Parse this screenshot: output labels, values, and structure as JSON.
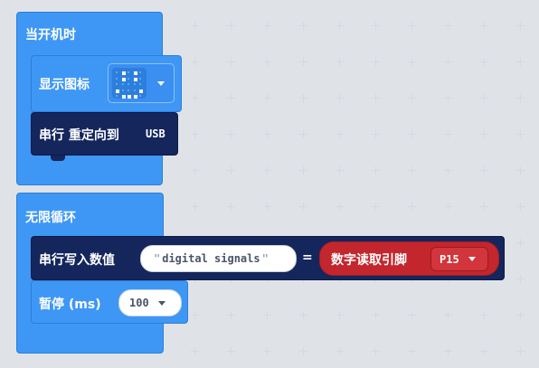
{
  "blocks": {
    "on_start": {
      "title": "当开机时",
      "show_icon": {
        "label": "显示图标",
        "icon_name": "smiley-icon"
      },
      "serial_redirect": {
        "label": "串行 重定向到",
        "target": "USB"
      }
    },
    "forever": {
      "title": "无限循环",
      "serial_write": {
        "label": "串行写入数值",
        "name_value": "digital signals",
        "equals": "=",
        "digital_read": {
          "label": "数字读取引脚",
          "pin": "P15"
        }
      },
      "pause": {
        "label": "暂停 (ms)",
        "value": "100"
      }
    }
  },
  "colors": {
    "canvas": "#f2f3f5",
    "basic_blue": "#3e97f5",
    "serial_navy": "#14265c",
    "pins_red": "#c3262d"
  }
}
